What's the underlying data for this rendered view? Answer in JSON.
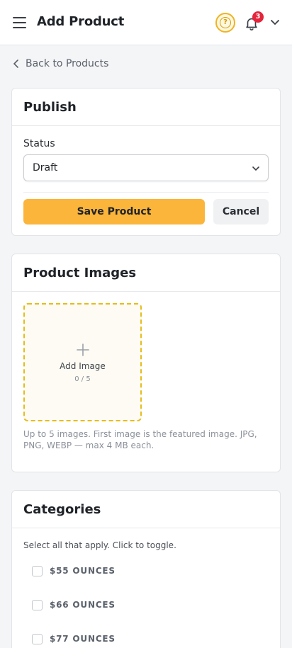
{
  "header": {
    "title": "Add Product",
    "menu_icon": "hamburger-menu-icon",
    "help_icon": "help-circle-icon",
    "help_glyph": "?",
    "notifications_icon": "bell-icon",
    "notification_count": "3",
    "account_icon": "chevron-down-icon"
  },
  "back_link": {
    "label": "Back to Products",
    "icon": "chevron-left-icon"
  },
  "publish": {
    "title": "Publish",
    "status_label": "Status",
    "status_value": "Draft",
    "save_label": "Save Product",
    "cancel_label": "Cancel"
  },
  "images": {
    "title": "Product Images",
    "add_label": "Add Image",
    "count": "0 / 5",
    "help": "Up to 5 images. First image is the featured image. JPG, PNG, WEBP — max 4 MB each."
  },
  "categories": {
    "title": "Categories",
    "help": "Select all that apply. Click to toggle.",
    "items": [
      {
        "label": "$55 OUNCES",
        "checked": false
      },
      {
        "label": "$66 OUNCES",
        "checked": false
      },
      {
        "label": "$77 OUNCES",
        "checked": false
      }
    ]
  },
  "colors": {
    "accent": "#fbb53a",
    "badge": "#e5243b",
    "dropzone_border": "#e5bd18"
  }
}
